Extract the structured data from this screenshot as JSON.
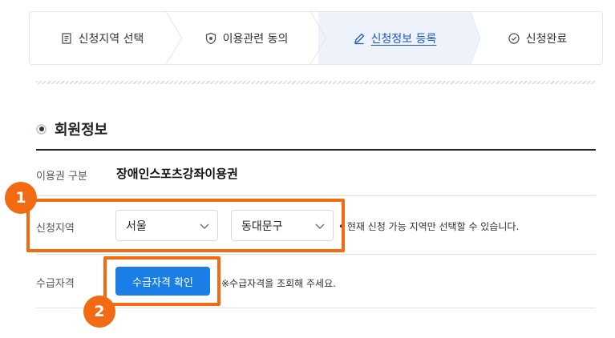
{
  "steps": [
    {
      "label": "신청지역 선택",
      "icon": "document-icon"
    },
    {
      "label": "이용관련 동의",
      "icon": "shield-icon"
    },
    {
      "label": "신청정보 등록",
      "icon": "pencil-icon",
      "active": true
    },
    {
      "label": "신청완료",
      "icon": "check-circle-icon"
    }
  ],
  "section": {
    "title": "회원정보"
  },
  "form": {
    "usage_type": {
      "label": "이용권 구분",
      "value": "장애인스포츠강좌이용권"
    },
    "region": {
      "label": "신청지역",
      "city": "서울",
      "district": "동대문구",
      "note": "• 현재 신청 가능 지역만 선택할 수 있습니다."
    },
    "eligibility": {
      "label": "수급자격",
      "button": "수급자격 확인",
      "note": "※수급자격을 조회해 주세요."
    }
  },
  "annotations": {
    "badge1": "1",
    "badge2": "2"
  },
  "colors": {
    "accent": "#1a7ee6",
    "highlight": "#f26b12",
    "active_step_bg": "#eef3fb"
  }
}
